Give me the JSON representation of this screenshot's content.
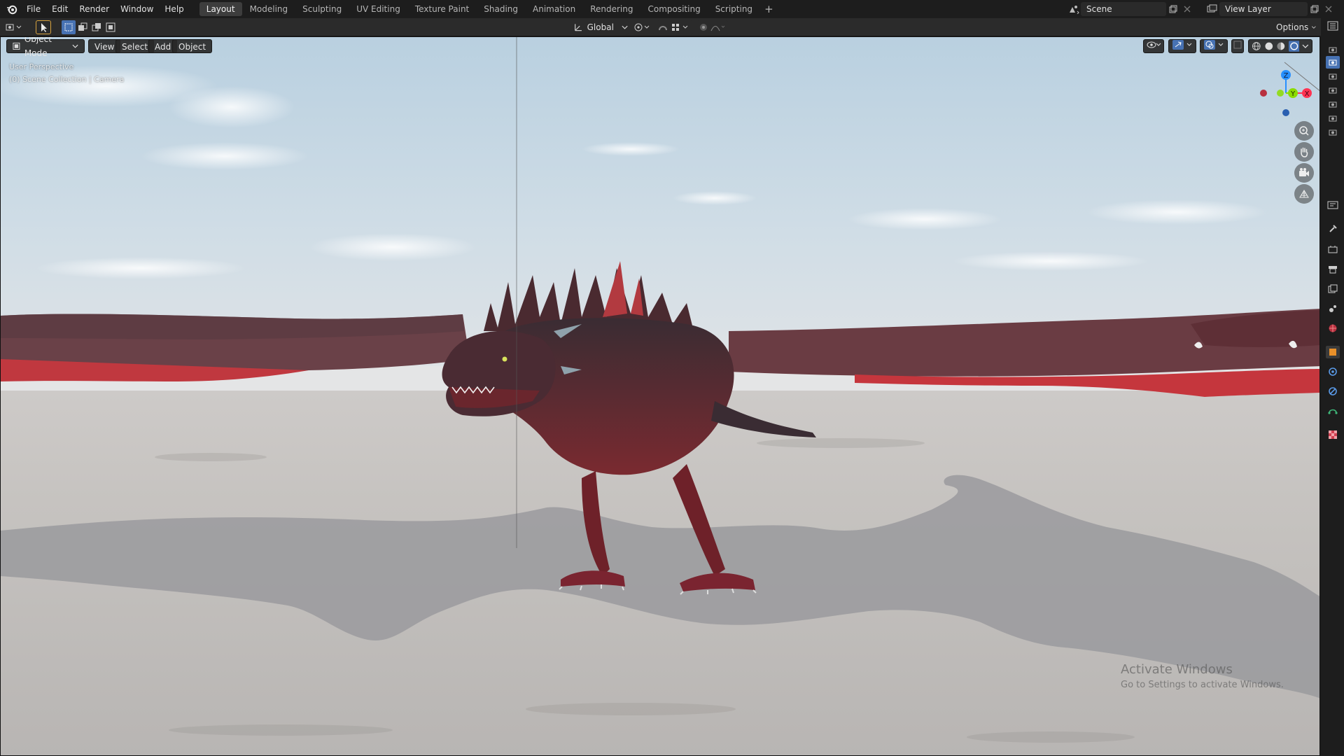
{
  "menu": {
    "items": [
      "File",
      "Edit",
      "Render",
      "Window",
      "Help"
    ]
  },
  "workspaces": {
    "tabs": [
      "Layout",
      "Modeling",
      "Sculpting",
      "UV Editing",
      "Texture Paint",
      "Shading",
      "Animation",
      "Rendering",
      "Compositing",
      "Scripting"
    ],
    "active": "Layout"
  },
  "scene": {
    "name": "Scene"
  },
  "view_layer": {
    "name": "View Layer"
  },
  "tool_header": {
    "transform_orientation": "Global",
    "options_label": "Options"
  },
  "viewport": {
    "mode": "Object Mode",
    "menus": [
      "View",
      "Select",
      "Add",
      "Object"
    ],
    "perspective_label": "User Perspective",
    "collection_label": "(0) Scene Collection | Camera",
    "gizmo_axis": {
      "z": "Z",
      "y": "Y",
      "x": "X"
    }
  },
  "watermark": {
    "title": "Activate Windows",
    "subtitle": "Go to Settings to activate Windows."
  },
  "icons": {
    "logo": "blender-logo-icon",
    "select": "cursor-select-icon",
    "zoom": "zoom-icon",
    "pan": "hand-pan-icon",
    "camera": "camera-view-icon",
    "grid": "orthographic-grid-icon"
  },
  "colors": {
    "ui_dark": "#1d1d1d",
    "ui_header": "#2b2b2b",
    "accent_blue": "#4772b3",
    "axis_x": "#ff3352",
    "axis_y": "#8bdc00",
    "axis_z": "#2890ff",
    "sky_top": "#c7d9e6",
    "ground": "#c2bebb"
  }
}
